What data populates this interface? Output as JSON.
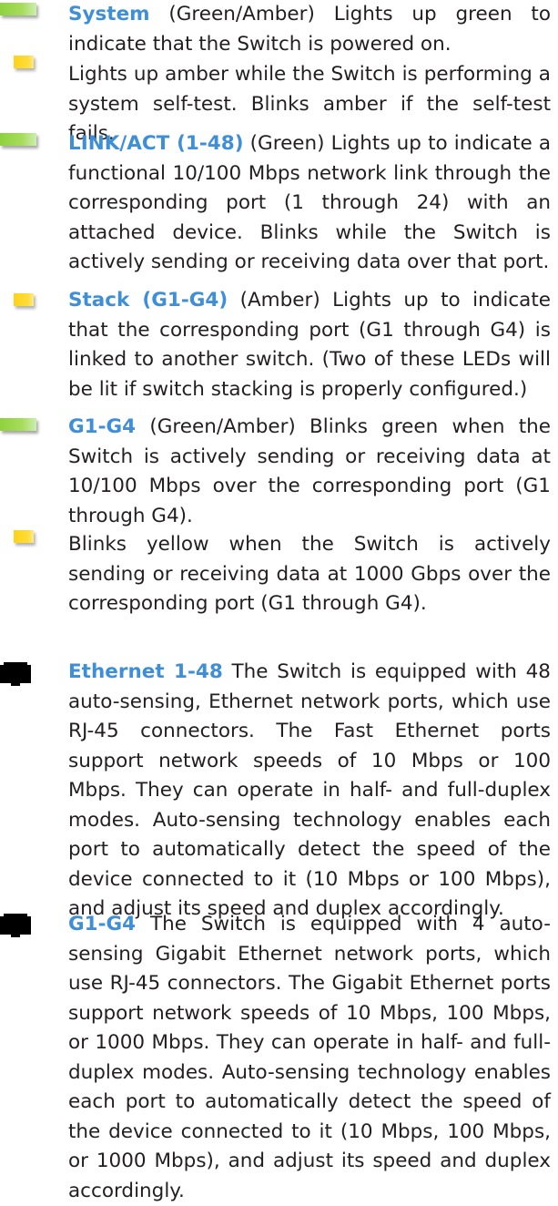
{
  "items": [
    {
      "icon": "green-led-icon",
      "label": "System",
      "text": " (Green/Amber) Lights up green to indicate that the Switch is powered on."
    },
    {
      "icon": "amber-led-icon",
      "label": "",
      "text": "Lights up amber while the Switch is performing a system self-test. Blinks amber if the self-test fails."
    },
    {
      "icon": "green-led-icon",
      "label": "LINK/ACT (1-48)",
      "text": " (Green) Lights up to indicate a functional 10/100 Mbps network link through the corresponding port (1 through 24) with an attached device. Blinks while the Switch is actively sending or receiving data over that port."
    },
    {
      "icon": "amber-led-icon",
      "label": "Stack (G1-G4)",
      "text": " (Amber) Lights up to indicate that the corresponding port (G1 through G4) is linked to another switch. (Two of these LEDs will be lit if switch stacking is properly configured.)"
    },
    {
      "icon": "green-led-icon",
      "label": "G1-G4",
      "text": " (Green/Amber) Blinks green when the Switch is actively sending or receiving data at 10/100 Mbps over the corresponding port (G1 through G4)."
    },
    {
      "icon": "amber-led-icon",
      "label": "",
      "text": "Blinks yellow when the Switch is actively sending or receiving data at 1000 Gbps over the corresponding port (G1 through G4)."
    },
    {
      "icon": "rj45-port-icon",
      "label": "Ethernet 1-48",
      "text": " The Switch is equipped with 48 auto-sensing, Ethernet network ports, which use RJ-45 connectors. The Fast Ethernet ports support network speeds of 10 Mbps or 100 Mbps. They can operate in half- and full-duplex modes. Auto-sensing technology enables each port to automatically detect the speed of the device connected to it (10 Mbps or 100 Mbps), and adjust its speed and duplex accordingly."
    },
    {
      "icon": "rj45-port-icon",
      "label": "G1-G4",
      "text": " The Switch is equipped with 4 auto-sensing Gigabit Ethernet network ports, which use RJ-45 connectors. The Gigabit Ethernet ports support network speeds of 10 Mbps, 100 Mbps, or 1000 Mbps. They can operate in half- and full-duplex modes. Auto-sensing technology enables each port to automatically detect the speed of the device connected to it (10 Mbps, 100 Mbps, or 1000 Mbps), and adjust its speed and duplex accordingly."
    }
  ],
  "colors": {
    "label": "#3f8fd8",
    "text": "#231f20",
    "green_led": "#a6dc5b",
    "amber_led": "#ffd21a",
    "port_icon": "#000000"
  }
}
